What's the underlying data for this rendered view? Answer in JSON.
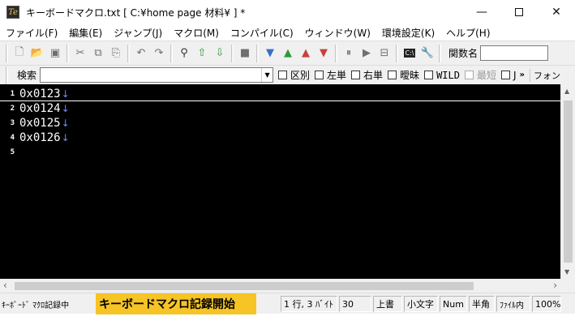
{
  "window": {
    "title": "キーボードマクロ.txt [ C:¥home page 材料¥ ] *",
    "app_icon_text": "Te",
    "minimize_icon": "minimize-icon",
    "maximize_icon": "maximize-icon",
    "close_icon": "close-icon"
  },
  "menu": [
    "ファイル(F)",
    "編集(E)",
    "ジャンプ(J)",
    "マクロ(M)",
    "コンパイル(C)",
    "ウィンドウ(W)",
    "環境設定(K)",
    "ヘルプ(H)"
  ],
  "toolbar": {
    "function_name_label": "関数名",
    "function_name_value": ""
  },
  "search": {
    "label": "検索",
    "value": "",
    "options": [
      {
        "label": "区別",
        "checked": false,
        "enabled": true
      },
      {
        "label": "左単",
        "checked": false,
        "enabled": true
      },
      {
        "label": "右単",
        "checked": false,
        "enabled": true
      },
      {
        "label": "曖昧",
        "checked": false,
        "enabled": true
      },
      {
        "label": "WILD",
        "checked": false,
        "enabled": true
      },
      {
        "label": "最短",
        "checked": false,
        "enabled": false
      }
    ],
    "truncated_option": "J",
    "overflow_chevron": "»",
    "extra_label": "フォン"
  },
  "editor": {
    "background": "#000000",
    "text_color": "#ffffff",
    "eol_color": "#6f8cff",
    "lines": [
      {
        "number": "1",
        "text": "0x0123",
        "eol": "↓"
      },
      {
        "number": "2",
        "text": "0x0124",
        "eol": "↓"
      },
      {
        "number": "3",
        "text": "0x0125",
        "eol": "↓"
      },
      {
        "number": "4",
        "text": "0x0126",
        "eol": "↓"
      },
      {
        "number": "5",
        "text": "",
        "eol": ""
      }
    ]
  },
  "statusbar": {
    "macro_status": "ｷｰﾎﾞｰﾄﾞ ﾏｸﾛ記録中",
    "macro_banner": "キーボードマクロ記録開始",
    "banner_color": "#f6c425",
    "position": "1 行, 3 ﾊﾞｲﾄ",
    "code": "30",
    "overwrite": "上書",
    "case": "小文字",
    "numlock": "Num",
    "width": "半角",
    "file_scope": "ﾌｧｲﾙ内",
    "zoom": "100%"
  }
}
